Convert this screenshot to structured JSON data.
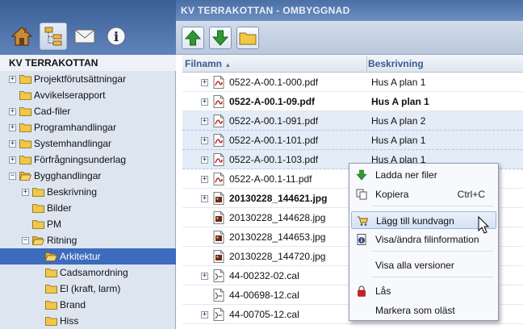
{
  "window": {
    "title": "KV TERRAKOTTAN - OMBYGGNAD"
  },
  "left": {
    "top_icons": [
      "home-icon",
      "tree-icon",
      "mail-icon",
      "info-icon"
    ],
    "tree_title": "KV TERRAKOTTAN",
    "tree": [
      {
        "label": "Projektförutsättningar",
        "expander": "+"
      },
      {
        "label": "Avvikelserapport",
        "expander": ""
      },
      {
        "label": "Cad-filer",
        "expander": "+"
      },
      {
        "label": "Programhandlingar",
        "expander": "+"
      },
      {
        "label": "Systemhandlingar",
        "expander": "+"
      },
      {
        "label": "Förfrågningsunderlag",
        "expander": "+"
      },
      {
        "label": "Bygghandlingar",
        "expander": "−"
      },
      {
        "label": "Beskrivning",
        "expander": "+"
      },
      {
        "label": "Bilder",
        "expander": ""
      },
      {
        "label": "PM",
        "expander": ""
      },
      {
        "label": "Ritning",
        "expander": "−"
      },
      {
        "label": "Arkitektur",
        "expander": "",
        "selected": true
      },
      {
        "label": "Cadsamordning",
        "expander": ""
      },
      {
        "label": "El (kraft, larm)",
        "expander": ""
      },
      {
        "label": "Brand",
        "expander": ""
      },
      {
        "label": "Hiss",
        "expander": ""
      }
    ]
  },
  "toolbar": {
    "buttons": [
      "upload-arrow-icon",
      "download-arrow-icon",
      "new-folder-icon"
    ]
  },
  "columns": {
    "name": "Filnamn",
    "description": "Beskrivning"
  },
  "files": [
    {
      "name": "0522-A-00.1-000.pdf",
      "desc": "Hus A plan 1",
      "type": "pdf",
      "expander": true,
      "bold": false,
      "hl": false
    },
    {
      "name": "0522-A-00.1-09.pdf",
      "desc": "Hus A plan 1",
      "type": "pdf",
      "expander": true,
      "bold": true,
      "hl": false
    },
    {
      "name": "0522-A-00.1-091.pdf",
      "desc": "Hus A plan 2",
      "type": "pdf",
      "expander": true,
      "bold": false,
      "hl": true
    },
    {
      "name": "0522-A-00.1-101.pdf",
      "desc": "Hus A plan 1",
      "type": "pdf",
      "expander": true,
      "bold": false,
      "hl": true
    },
    {
      "name": "0522-A-00.1-103.pdf",
      "desc": "Hus A plan 1",
      "type": "pdf",
      "expander": true,
      "bold": false,
      "hl": true
    },
    {
      "name": "0522-A-00.1-11.pdf",
      "desc": "",
      "type": "pdf",
      "expander": true,
      "bold": false,
      "hl": false
    },
    {
      "name": "20130228_144621.jpg",
      "desc": "",
      "type": "jpg",
      "expander": true,
      "bold": true,
      "hl": false
    },
    {
      "name": "20130228_144628.jpg",
      "desc": "",
      "type": "jpg",
      "expander": false,
      "bold": false,
      "hl": false
    },
    {
      "name": "20130228_144653.jpg",
      "desc": "",
      "type": "jpg",
      "expander": false,
      "bold": false,
      "hl": false
    },
    {
      "name": "20130228_144720.jpg",
      "desc": "",
      "type": "jpg",
      "expander": false,
      "bold": false,
      "hl": false
    },
    {
      "name": "44-00232-02.cal",
      "desc": "",
      "type": "cal",
      "expander": true,
      "bold": false,
      "hl": false
    },
    {
      "name": "44-00698-12.cal",
      "desc": "",
      "type": "cal",
      "expander": false,
      "bold": false,
      "hl": false
    },
    {
      "name": "44-00705-12.cal",
      "desc": "",
      "type": "cal",
      "expander": true,
      "bold": false,
      "hl": false
    }
  ],
  "context_menu": [
    {
      "label": "Ladda ner filer",
      "icon": "download-icon",
      "shortcut": ""
    },
    {
      "label": "Kopiera",
      "icon": "copy-icon",
      "shortcut": "Ctrl+C"
    },
    {
      "label": "Lägg till kundvagn",
      "icon": "cart-icon",
      "shortcut": "",
      "hover": true
    },
    {
      "label": "Visa/ändra filinformation",
      "icon": "file-info-icon",
      "shortcut": ""
    },
    {
      "label": "Visa alla versioner",
      "icon": "",
      "shortcut": ""
    },
    {
      "label": "Lås",
      "icon": "lock-icon",
      "shortcut": ""
    },
    {
      "label": "Markera som oläst",
      "icon": "",
      "shortcut": ""
    }
  ],
  "colors": {
    "selection": "#3d6bbd",
    "title_bar": "#4a6fa5",
    "panel_bg": "#dde5f0"
  }
}
